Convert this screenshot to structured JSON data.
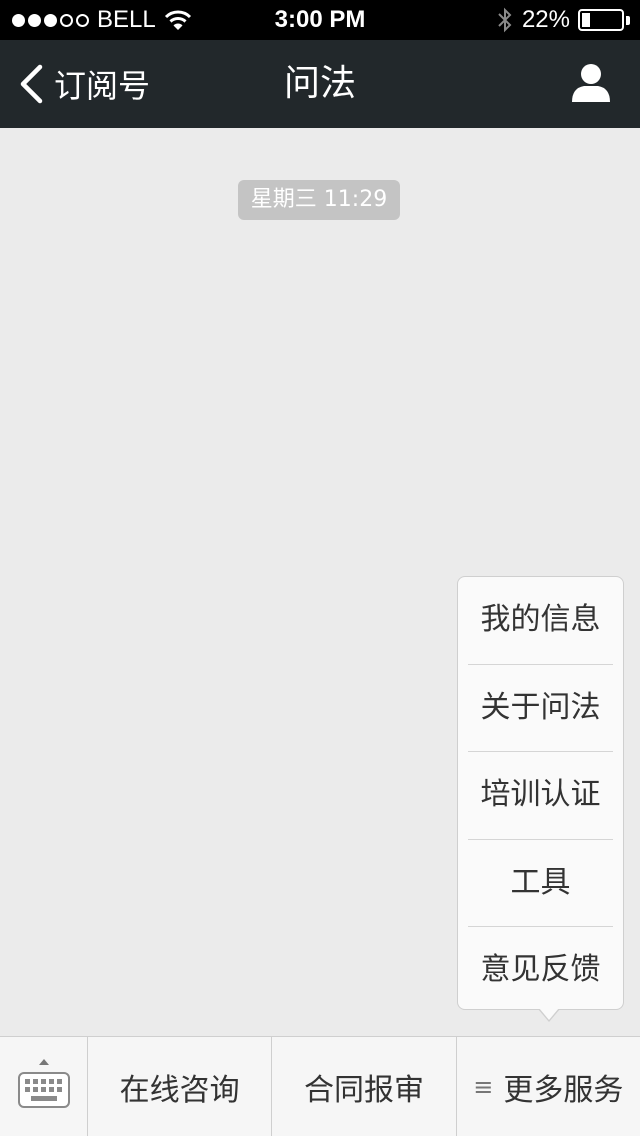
{
  "status_bar": {
    "carrier": "BELL",
    "signal_bars_filled": 3,
    "signal_bars_total": 5,
    "time": "3:00 PM",
    "battery_percent": "22%",
    "battery_level": 0.22,
    "icons": [
      "wifi-icon",
      "bluetooth-icon",
      "battery-icon"
    ]
  },
  "navbar": {
    "back_label": "订阅号",
    "title": "问法",
    "icons": [
      "chevron-left-icon",
      "profile-icon"
    ]
  },
  "chat": {
    "timestamp": "星期三 11:29"
  },
  "popup_menu": {
    "items": [
      {
        "label": "我的信息"
      },
      {
        "label": "关于问法"
      },
      {
        "label": "培训认证"
      },
      {
        "label": "工具"
      },
      {
        "label": "意见反馈"
      }
    ]
  },
  "menu_bar": {
    "keyboard_icon": "keyboard-icon",
    "buttons": [
      {
        "label": "在线咨询"
      },
      {
        "label": "合同报审"
      },
      {
        "label": "更多服务",
        "icon": "≡"
      }
    ]
  },
  "colors": {
    "navbar_bg": "#22282b",
    "chat_bg": "#ebebeb",
    "timestamp_bg": "#c4c4c4"
  }
}
